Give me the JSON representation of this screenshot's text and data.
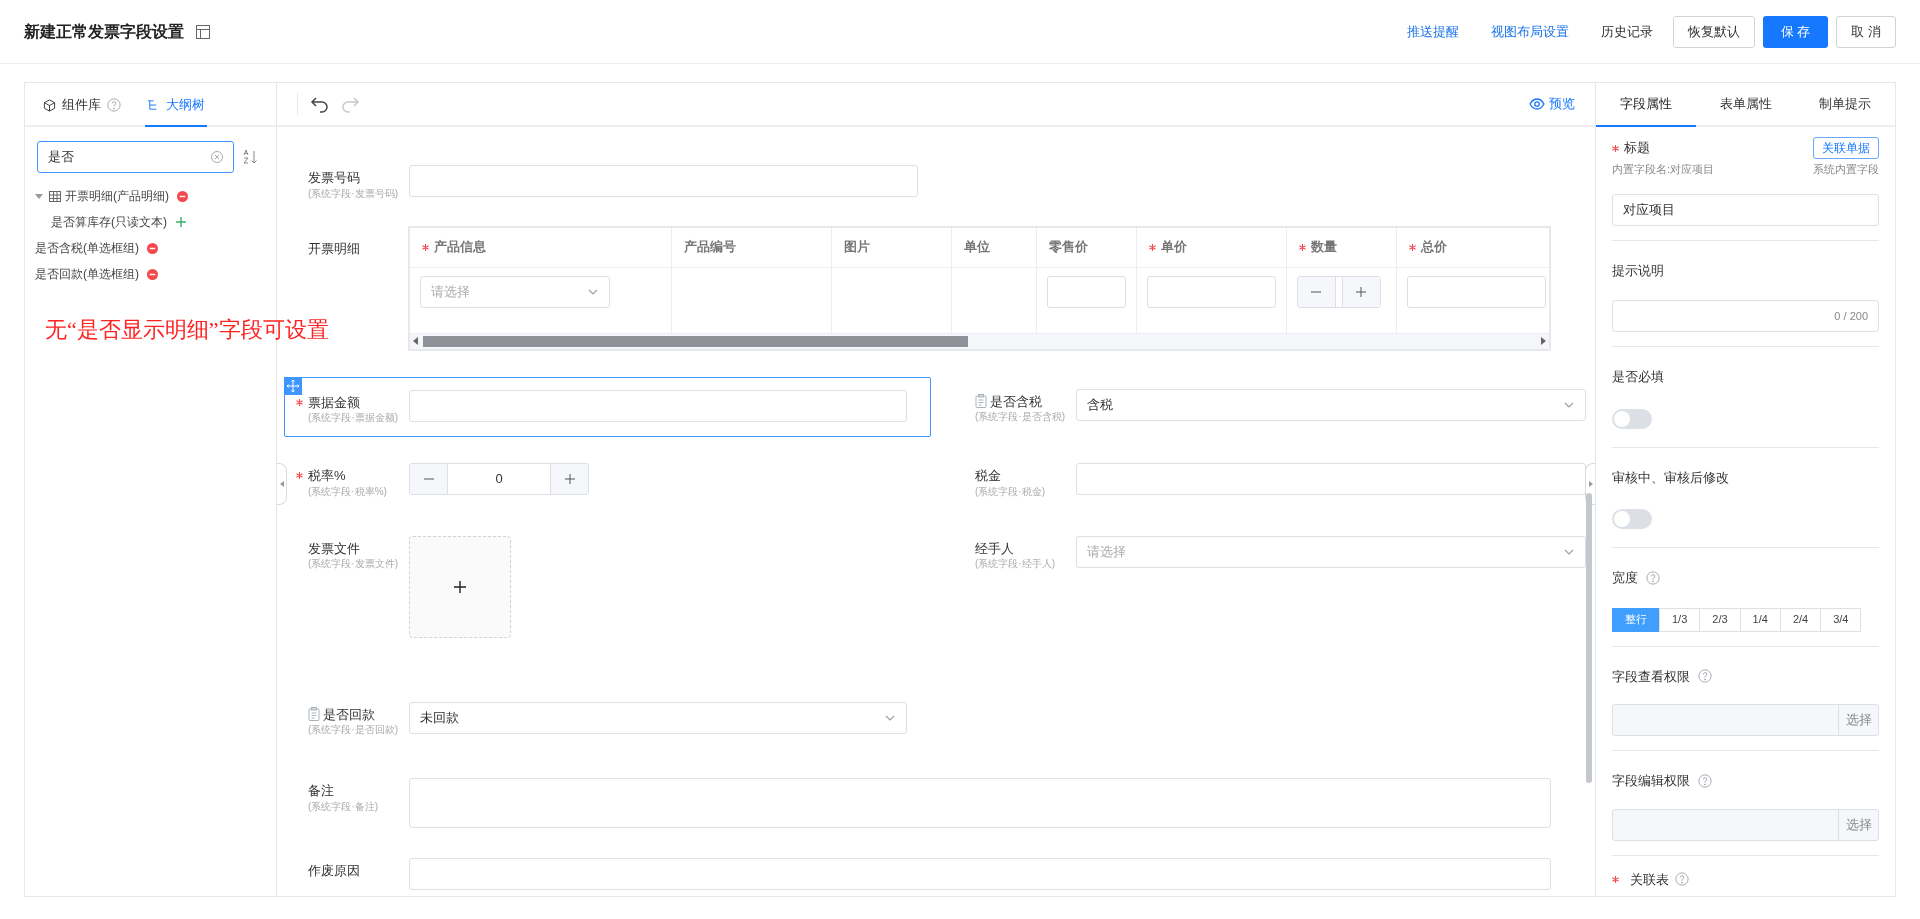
{
  "header": {
    "title": "新建正常发票字段设置",
    "actions": [
      {
        "label": "推送提醒",
        "kind": "link"
      },
      {
        "label": "视图布局设置",
        "kind": "link"
      },
      {
        "label": "历史记录",
        "kind": "text"
      },
      {
        "label": "恢复默认",
        "kind": "outline"
      },
      {
        "label": "保 存",
        "kind": "primary"
      },
      {
        "label": "取 消",
        "kind": "outline"
      }
    ]
  },
  "left_panel": {
    "tabs": [
      {
        "label": "组件库",
        "selected": false,
        "help": true
      },
      {
        "label": "大纲树",
        "selected": true,
        "help": false
      }
    ],
    "search": {
      "value": "是否"
    },
    "tree": [
      {
        "label": "开票明细(产品明细)",
        "table_icon": true,
        "removable": true,
        "expanded": true,
        "children": [
          {
            "label": "是否算库存(只读文本)",
            "table_icon": false,
            "removable": false
          }
        ]
      },
      {
        "label": "是否含税(单选框组)",
        "table_icon": false,
        "removable": true
      },
      {
        "label": "是否回款(单选框组)",
        "table_icon": false,
        "removable": true
      }
    ],
    "annotation": "无“是否显示明细”字段可设置"
  },
  "canvas": {
    "preview": "预览",
    "fields_top": {
      "label": "发票号码",
      "sublabel": "(系统字段·发票号码)",
      "required": false,
      "kind": "input",
      "doc_icon": false,
      "selected": false
    },
    "table": {
      "label": "开票明细",
      "columns": [
        {
          "label": "产品信息",
          "required": true
        },
        {
          "label": "产品编号",
          "required": false
        },
        {
          "label": "图片",
          "required": false
        },
        {
          "label": "单位",
          "required": false
        },
        {
          "label": "零售价",
          "required": false
        },
        {
          "label": "单价",
          "required": true
        },
        {
          "label": "数量",
          "required": true
        },
        {
          "label": "总价",
          "required": true
        }
      ],
      "row": [
        {
          "kind": "select",
          "placeholder": "请选择"
        },
        {
          "kind": "empty"
        },
        {
          "kind": "empty"
        },
        {
          "kind": "empty"
        },
        {
          "kind": "input"
        },
        {
          "kind": "input"
        },
        {
          "kind": "stepper"
        },
        {
          "kind": "input"
        }
      ]
    },
    "rows": [
      [
        {
          "label": "票据金额",
          "sublabel": "(系统字段·票据金额)",
          "required": true,
          "kind": "input",
          "doc_icon": false,
          "selected": true
        },
        {
          "label": "是否含税",
          "sublabel": "(系统字段·是否含税)",
          "required": false,
          "kind": "select",
          "value": "含税",
          "doc_icon": true,
          "selected": false
        }
      ],
      [
        {
          "label": "税率%",
          "sublabel": "(系统字段·税率%)",
          "required": true,
          "kind": "stepper",
          "value": "0",
          "doc_icon": false,
          "selected": false
        },
        {
          "label": "税金",
          "sublabel": "(系统字段·税金)",
          "required": false,
          "kind": "input",
          "doc_icon": false,
          "selected": false
        }
      ],
      [
        {
          "label": "发票文件",
          "sublabel": "(系统字段·发票文件)",
          "required": false,
          "kind": "upload",
          "doc_icon": false,
          "selected": false
        },
        {
          "label": "经手人",
          "sublabel": "(系统字段·经手人)",
          "required": false,
          "kind": "select",
          "placeholder": "请选择",
          "doc_icon": false,
          "selected": false
        }
      ],
      [
        {
          "label": "是否回款",
          "sublabel": "(系统字段·是否回款)",
          "required": false,
          "kind": "select",
          "value": "未回款",
          "doc_icon": true,
          "selected": false
        }
      ]
    ],
    "wide_rows": [
      {
        "label": "备注",
        "sublabel": "(系统字段·备注)",
        "kind": "textarea"
      },
      {
        "label": "作废原因",
        "kind": "input"
      }
    ]
  },
  "right_panel": {
    "tabs": [
      {
        "label": "字段属性",
        "selected": true
      },
      {
        "label": "表单属性",
        "selected": false
      },
      {
        "label": "制单提示",
        "selected": false
      }
    ],
    "title_field": {
      "label": "标题",
      "required": true,
      "link_button": "关联单据",
      "builtin_name": "内置字段名:对应项目",
      "builtin_note": "系统内置字段",
      "value": "对应项目"
    },
    "hint_field": {
      "label": "提示说明",
      "counter": "0 / 200"
    },
    "switches": [
      {
        "label": "是否必填",
        "on": false
      },
      {
        "label": "审核中、审核后修改",
        "on": false
      }
    ],
    "width": {
      "label": "宽度",
      "options": [
        {
          "label": "整行",
          "selected": true
        },
        {
          "label": "1/3",
          "selected": false
        },
        {
          "label": "2/3",
          "selected": false
        },
        {
          "label": "1/4",
          "selected": false
        },
        {
          "label": "2/4",
          "selected": false
        },
        {
          "label": "3/4",
          "selected": false
        }
      ]
    },
    "permissions": [
      {
        "label": "字段查看权限",
        "button": "选择"
      },
      {
        "label": "字段编辑权限",
        "button": "选择"
      }
    ],
    "last_field": {
      "label": "关联表",
      "required": true
    }
  }
}
